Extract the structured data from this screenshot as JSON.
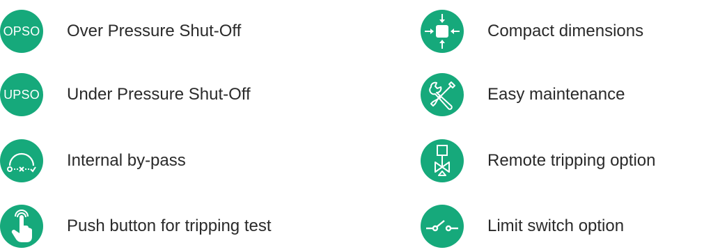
{
  "accent_color": "#16a97b",
  "features_left": [
    {
      "icon": "opso-text-icon",
      "icon_text": "OPSO",
      "label": "Over Pressure Shut-Off"
    },
    {
      "icon": "upso-text-icon",
      "icon_text": "UPSO",
      "label": "Under Pressure Shut-Off"
    },
    {
      "icon": "bypass-arc-icon",
      "label": "Internal by-pass"
    },
    {
      "icon": "touch-button-icon",
      "label": "Push button for tripping test"
    }
  ],
  "features_right": [
    {
      "icon": "compact-arrows-icon",
      "label": "Compact dimensions"
    },
    {
      "icon": "wrench-screwdriver-icon",
      "label": "Easy maintenance"
    },
    {
      "icon": "valve-actuator-icon",
      "label": "Remote tripping option"
    },
    {
      "icon": "switch-icon",
      "label": "Limit switch option"
    }
  ]
}
